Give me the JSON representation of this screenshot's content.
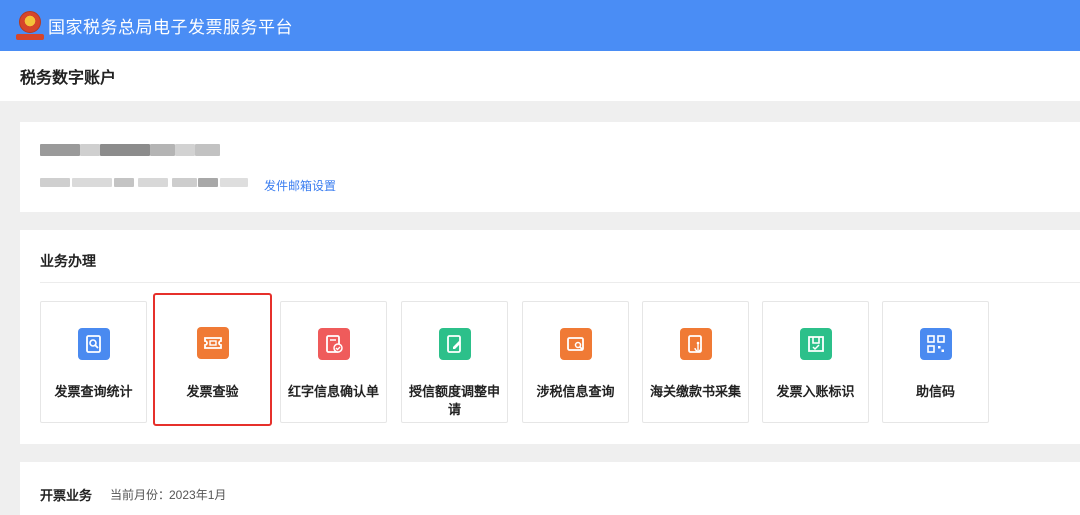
{
  "header": {
    "title": "国家税务总局电子发票服务平台",
    "brand_color": "#4a8df5"
  },
  "subheader": {
    "title": "税务数字账户"
  },
  "account": {
    "email_settings_link": "发件邮箱设置",
    "link_color": "#3a7df0"
  },
  "business": {
    "title": "业务办理",
    "tiles": [
      {
        "label": "发票查询统计",
        "icon": "search-document-icon",
        "color": "#4a8af0",
        "highlighted": false
      },
      {
        "label": "发票查验",
        "icon": "ticket-icon",
        "color": "#f07a35",
        "highlighted": true
      },
      {
        "label": "红字信息确认单",
        "icon": "confirm-document-icon",
        "color": "#ef5b5b",
        "highlighted": false
      },
      {
        "label": "授信额度调整申请",
        "icon": "edit-document-icon",
        "color": "#2cc08a",
        "highlighted": false
      },
      {
        "label": "涉税信息查询",
        "icon": "folder-search-icon",
        "color": "#f07a35",
        "highlighted": false
      },
      {
        "label": "海关缴款书采集",
        "icon": "anchor-document-icon",
        "color": "#f07a35",
        "highlighted": false
      },
      {
        "label": "发票入账标识",
        "icon": "inbox-check-icon",
        "color": "#2cc08a",
        "highlighted": false
      },
      {
        "label": "助信码",
        "icon": "qr-code-icon",
        "color": "#4a8af0",
        "highlighted": false
      }
    ],
    "highlight_color": "#e6302b"
  },
  "invoice": {
    "title": "开票业务",
    "month_label": "当前月份：",
    "month_value": "2023年1月"
  }
}
